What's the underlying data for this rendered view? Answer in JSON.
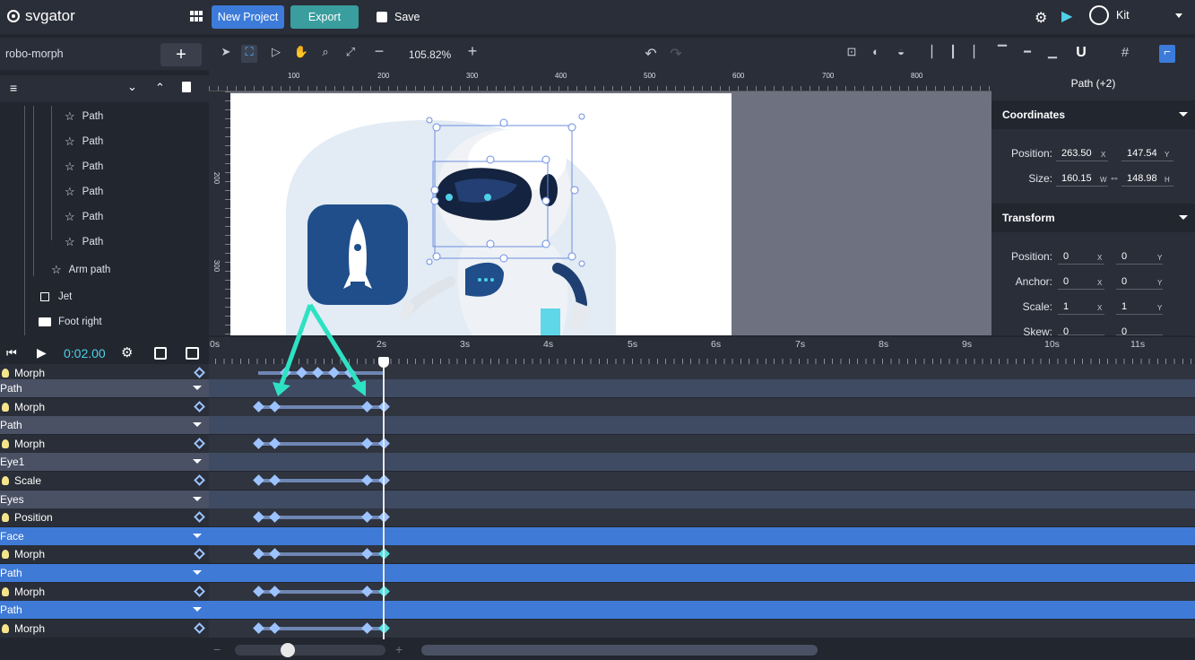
{
  "app": {
    "brand": "svgator"
  },
  "header": {
    "new_project": "New Project",
    "export": "Export",
    "save": "Save",
    "user": "Kit"
  },
  "project": {
    "name": "robo-morph"
  },
  "layers": [
    {
      "label": "Path"
    },
    {
      "label": "Path"
    },
    {
      "label": "Path"
    },
    {
      "label": "Path"
    },
    {
      "label": "Path"
    },
    {
      "label": "Path"
    },
    {
      "label": "Arm path"
    },
    {
      "label": "Jet"
    },
    {
      "label": "Foot right"
    }
  ],
  "toolbar": {
    "zoom": "105.82%"
  },
  "ruler": {
    "top": [
      "100",
      "200",
      "300",
      "400",
      "500",
      "600",
      "700",
      "800"
    ],
    "left": [
      "200",
      "300"
    ]
  },
  "inspector": {
    "title": "Path (+2)",
    "coordinates": {
      "heading": "Coordinates",
      "position_label": "Position:",
      "pos_x": "263.50",
      "pos_y": "147.54",
      "size_label": "Size:",
      "width": "160.15",
      "height": "148.98",
      "x_unit": "X",
      "y_unit": "Y",
      "w_unit": "W",
      "h_unit": "H"
    },
    "transform": {
      "heading": "Transform",
      "position_label": "Position:",
      "anchor_label": "Anchor:",
      "scale_label": "Scale:",
      "skew_label": "Skew:",
      "pos_x": "0",
      "pos_y": "0",
      "anchor_x": "0",
      "anchor_y": "0",
      "scale_x": "1",
      "scale_y": "1",
      "skew_x": "0",
      "skew_y": "0"
    }
  },
  "timeline": {
    "time": "0:02.00",
    "ticks": [
      "0s",
      "2s",
      "3s",
      "4s",
      "5s",
      "6s",
      "7s",
      "8s",
      "9s",
      "10s",
      "11s"
    ],
    "rows": [
      {
        "kind": "prop",
        "label": "Morph",
        "partial": true
      },
      {
        "kind": "grp",
        "label": "Path"
      },
      {
        "kind": "prop",
        "label": "Morph"
      },
      {
        "kind": "grp",
        "label": "Path"
      },
      {
        "kind": "prop",
        "label": "Morph"
      },
      {
        "kind": "grp",
        "label": "Eye1"
      },
      {
        "kind": "prop",
        "label": "Scale"
      },
      {
        "kind": "grp",
        "label": "Eyes"
      },
      {
        "kind": "prop",
        "label": "Position"
      },
      {
        "kind": "grp",
        "label": "Face",
        "selected": true
      },
      {
        "kind": "prop",
        "label": "Morph",
        "selected": true
      },
      {
        "kind": "grp",
        "label": "Path",
        "selected": true
      },
      {
        "kind": "prop",
        "label": "Morph",
        "selected": true
      },
      {
        "kind": "grp",
        "label": "Path",
        "selected": true
      },
      {
        "kind": "prop",
        "label": "Morph",
        "selected": true
      }
    ]
  },
  "colors": {
    "accent": "#3c7bd9",
    "export": "#3a9e9e",
    "highlight_arrow": "#2de2c2",
    "keyframe": "#9cc3ff",
    "keyframe_selected": "#4fe3e3"
  }
}
